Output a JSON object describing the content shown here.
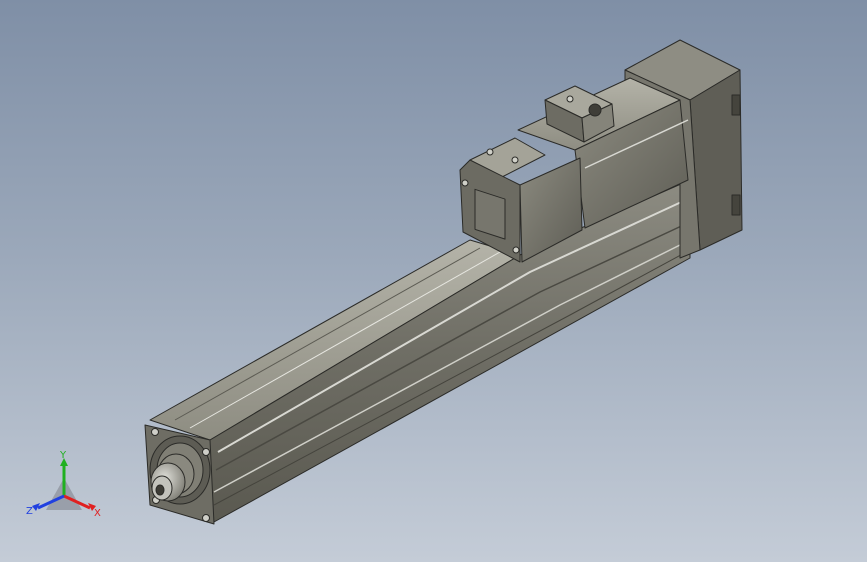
{
  "triad": {
    "x_label": "X",
    "y_label": "Y",
    "z_label": "Z",
    "x_color": "#e02020",
    "y_color": "#20b020",
    "z_color": "#2040e0"
  },
  "colors": {
    "body_light": "#9a988c",
    "body_mid": "#7b7a70",
    "body_dark": "#55544c",
    "edge": "#2b2b28",
    "highlight": "#d8d8d2"
  }
}
